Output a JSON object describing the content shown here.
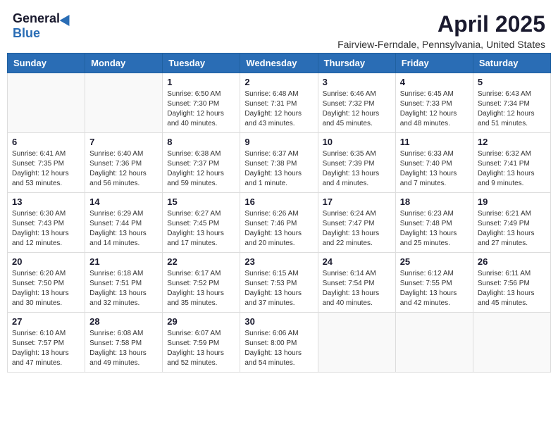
{
  "header": {
    "logo_general": "General",
    "logo_blue": "Blue",
    "month": "April 2025",
    "location": "Fairview-Ferndale, Pennsylvania, United States"
  },
  "weekdays": [
    "Sunday",
    "Monday",
    "Tuesday",
    "Wednesday",
    "Thursday",
    "Friday",
    "Saturday"
  ],
  "weeks": [
    [
      {
        "day": "",
        "info": ""
      },
      {
        "day": "",
        "info": ""
      },
      {
        "day": "1",
        "info": "Sunrise: 6:50 AM\nSunset: 7:30 PM\nDaylight: 12 hours and 40 minutes."
      },
      {
        "day": "2",
        "info": "Sunrise: 6:48 AM\nSunset: 7:31 PM\nDaylight: 12 hours and 43 minutes."
      },
      {
        "day": "3",
        "info": "Sunrise: 6:46 AM\nSunset: 7:32 PM\nDaylight: 12 hours and 45 minutes."
      },
      {
        "day": "4",
        "info": "Sunrise: 6:45 AM\nSunset: 7:33 PM\nDaylight: 12 hours and 48 minutes."
      },
      {
        "day": "5",
        "info": "Sunrise: 6:43 AM\nSunset: 7:34 PM\nDaylight: 12 hours and 51 minutes."
      }
    ],
    [
      {
        "day": "6",
        "info": "Sunrise: 6:41 AM\nSunset: 7:35 PM\nDaylight: 12 hours and 53 minutes."
      },
      {
        "day": "7",
        "info": "Sunrise: 6:40 AM\nSunset: 7:36 PM\nDaylight: 12 hours and 56 minutes."
      },
      {
        "day": "8",
        "info": "Sunrise: 6:38 AM\nSunset: 7:37 PM\nDaylight: 12 hours and 59 minutes."
      },
      {
        "day": "9",
        "info": "Sunrise: 6:37 AM\nSunset: 7:38 PM\nDaylight: 13 hours and 1 minute."
      },
      {
        "day": "10",
        "info": "Sunrise: 6:35 AM\nSunset: 7:39 PM\nDaylight: 13 hours and 4 minutes."
      },
      {
        "day": "11",
        "info": "Sunrise: 6:33 AM\nSunset: 7:40 PM\nDaylight: 13 hours and 7 minutes."
      },
      {
        "day": "12",
        "info": "Sunrise: 6:32 AM\nSunset: 7:41 PM\nDaylight: 13 hours and 9 minutes."
      }
    ],
    [
      {
        "day": "13",
        "info": "Sunrise: 6:30 AM\nSunset: 7:43 PM\nDaylight: 13 hours and 12 minutes."
      },
      {
        "day": "14",
        "info": "Sunrise: 6:29 AM\nSunset: 7:44 PM\nDaylight: 13 hours and 14 minutes."
      },
      {
        "day": "15",
        "info": "Sunrise: 6:27 AM\nSunset: 7:45 PM\nDaylight: 13 hours and 17 minutes."
      },
      {
        "day": "16",
        "info": "Sunrise: 6:26 AM\nSunset: 7:46 PM\nDaylight: 13 hours and 20 minutes."
      },
      {
        "day": "17",
        "info": "Sunrise: 6:24 AM\nSunset: 7:47 PM\nDaylight: 13 hours and 22 minutes."
      },
      {
        "day": "18",
        "info": "Sunrise: 6:23 AM\nSunset: 7:48 PM\nDaylight: 13 hours and 25 minutes."
      },
      {
        "day": "19",
        "info": "Sunrise: 6:21 AM\nSunset: 7:49 PM\nDaylight: 13 hours and 27 minutes."
      }
    ],
    [
      {
        "day": "20",
        "info": "Sunrise: 6:20 AM\nSunset: 7:50 PM\nDaylight: 13 hours and 30 minutes."
      },
      {
        "day": "21",
        "info": "Sunrise: 6:18 AM\nSunset: 7:51 PM\nDaylight: 13 hours and 32 minutes."
      },
      {
        "day": "22",
        "info": "Sunrise: 6:17 AM\nSunset: 7:52 PM\nDaylight: 13 hours and 35 minutes."
      },
      {
        "day": "23",
        "info": "Sunrise: 6:15 AM\nSunset: 7:53 PM\nDaylight: 13 hours and 37 minutes."
      },
      {
        "day": "24",
        "info": "Sunrise: 6:14 AM\nSunset: 7:54 PM\nDaylight: 13 hours and 40 minutes."
      },
      {
        "day": "25",
        "info": "Sunrise: 6:12 AM\nSunset: 7:55 PM\nDaylight: 13 hours and 42 minutes."
      },
      {
        "day": "26",
        "info": "Sunrise: 6:11 AM\nSunset: 7:56 PM\nDaylight: 13 hours and 45 minutes."
      }
    ],
    [
      {
        "day": "27",
        "info": "Sunrise: 6:10 AM\nSunset: 7:57 PM\nDaylight: 13 hours and 47 minutes."
      },
      {
        "day": "28",
        "info": "Sunrise: 6:08 AM\nSunset: 7:58 PM\nDaylight: 13 hours and 49 minutes."
      },
      {
        "day": "29",
        "info": "Sunrise: 6:07 AM\nSunset: 7:59 PM\nDaylight: 13 hours and 52 minutes."
      },
      {
        "day": "30",
        "info": "Sunrise: 6:06 AM\nSunset: 8:00 PM\nDaylight: 13 hours and 54 minutes."
      },
      {
        "day": "",
        "info": ""
      },
      {
        "day": "",
        "info": ""
      },
      {
        "day": "",
        "info": ""
      }
    ]
  ]
}
